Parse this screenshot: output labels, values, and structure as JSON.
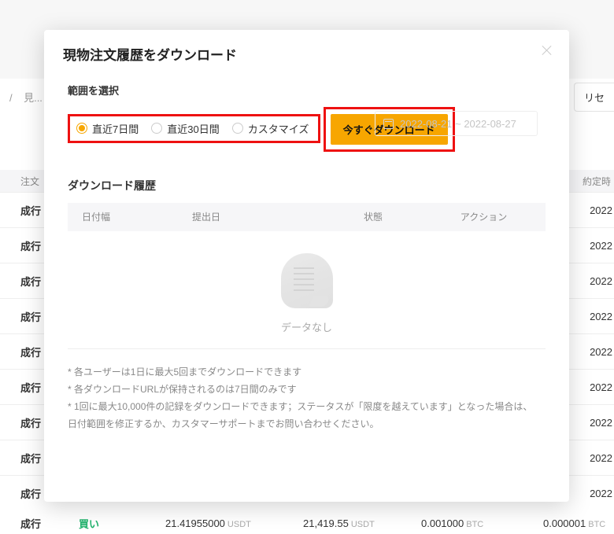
{
  "background": {
    "breadcrumb_sep": "/",
    "breadcrumb_partial": "見...",
    "reset_btn": "リセ",
    "col_order": "注文",
    "col_exec_at": "約定時",
    "rows": [
      {
        "type": "成行",
        "date": "2022"
      },
      {
        "type": "成行",
        "date": "2022"
      },
      {
        "type": "成行",
        "date": "2022"
      },
      {
        "type": "成行",
        "date": "2022"
      },
      {
        "type": "成行",
        "date": "2022"
      },
      {
        "type": "成行",
        "date": "2022"
      },
      {
        "type": "成行",
        "date": "2022"
      },
      {
        "type": "成行",
        "date": "2022"
      },
      {
        "type": "成行",
        "date": "2022"
      }
    ],
    "last_row": {
      "ordtype": "成行",
      "side": "買い",
      "qty": "21.41955000",
      "qty_unit": "USDT",
      "price": "21,419.55",
      "price_unit": "USDT",
      "amt1": "0.001000",
      "amt1_unit": "BTC",
      "amt2": "0.000001",
      "amt2_unit": "BTC"
    }
  },
  "modal": {
    "title": "現物注文履歴をダウンロード",
    "range_label": "範囲を選択",
    "options": {
      "opt7": "直近7日間",
      "opt30": "直近30日間",
      "custom": "カスタマイズ"
    },
    "date_range": "2022-08-21 ~ 2022-08-27",
    "download_btn": "今すぐダウンロード",
    "history_label": "ダウンロード履歴",
    "cols": {
      "c1": "日付幅",
      "c2": "提出日",
      "c3": "状態",
      "c4": "アクション"
    },
    "empty_text": "データなし",
    "notes": {
      "n1": "* 各ユーザーは1日に最大5回までダウンロードできます",
      "n2": "* 各ダウンロードURLが保持されるのは7日間のみです",
      "n3a": "* 1回に最大10,000件の記録をダウンロードできます；ステータスが「限度を越えています」となった場合は、",
      "n3b": "日付範囲を修正するか、カスタマーサポートまでお問い合わせください。"
    }
  }
}
